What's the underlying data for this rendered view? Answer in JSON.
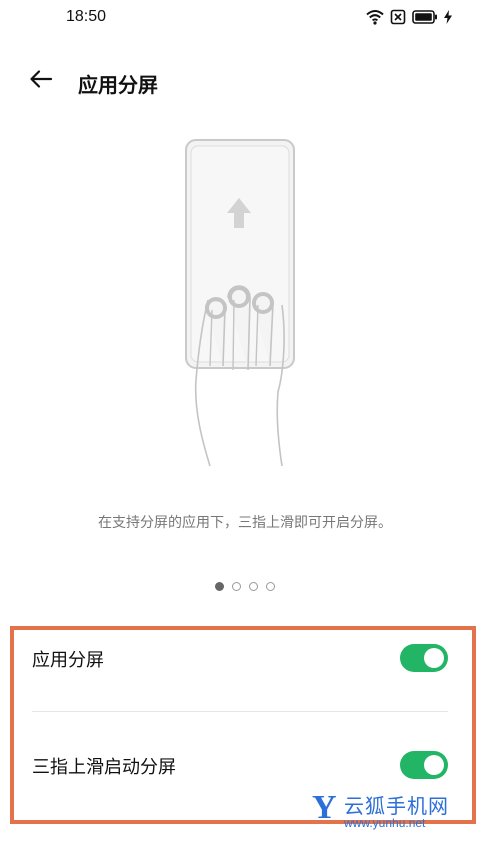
{
  "status_bar": {
    "time": "18:50",
    "icons": [
      "wifi-icon",
      "sim-off-icon",
      "battery-icon",
      "charging-icon"
    ]
  },
  "header": {
    "title": "应用分屏",
    "back_icon": "arrow-left-icon"
  },
  "illustration": {
    "icon": "three-finger-swipe-up-illustration"
  },
  "description": "在支持分屏的应用下，三指上滑即可开启分屏。",
  "pager": {
    "total": 4,
    "active_index": 0
  },
  "settings": [
    {
      "label": "应用分屏",
      "enabled": true
    },
    {
      "label": "三指上滑启动分屏",
      "enabled": true
    }
  ],
  "watermark": {
    "logo_letter": "Y",
    "text": "云狐手机网",
    "url": "www.yunhu.net"
  },
  "colors": {
    "toggle_on": "#22b566",
    "highlight_border": "#e3734a",
    "watermark": "#2b6fd8"
  }
}
